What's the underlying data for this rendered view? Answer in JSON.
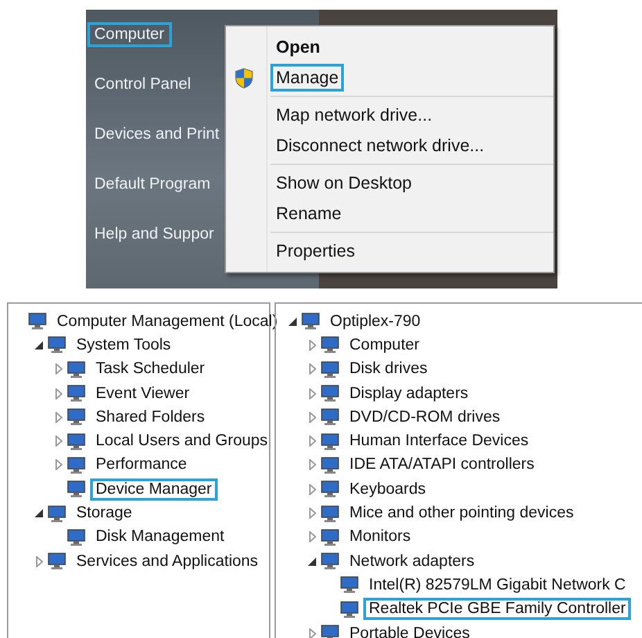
{
  "start_menu": {
    "items": [
      {
        "label": "Computer",
        "highlighted": true
      },
      {
        "label": "Control Panel",
        "highlighted": false
      },
      {
        "label": "Devices and Print",
        "highlighted": false
      },
      {
        "label": "Default Program",
        "highlighted": false
      },
      {
        "label": "Help and Suppor",
        "highlighted": false
      }
    ]
  },
  "context_menu": {
    "groups": [
      {
        "items": [
          {
            "label": "Open",
            "kind": "plain",
            "default": true,
            "highlighted": false
          },
          {
            "label": "Manage",
            "kind": "elevated",
            "default": false,
            "highlighted": true
          }
        ]
      },
      {
        "items": [
          {
            "label": "Map network drive...",
            "kind": "plain",
            "default": false,
            "highlighted": false
          },
          {
            "label": "Disconnect network drive...",
            "kind": "plain",
            "default": false,
            "highlighted": false
          }
        ]
      },
      {
        "items": [
          {
            "label": "Show on Desktop",
            "kind": "plain",
            "default": false,
            "highlighted": false
          },
          {
            "label": "Rename",
            "kind": "plain",
            "default": false,
            "highlighted": false
          }
        ]
      },
      {
        "items": [
          {
            "label": "Properties",
            "kind": "plain",
            "default": false,
            "highlighted": false
          }
        ]
      }
    ]
  },
  "management_tree": {
    "nodes": [
      {
        "label": "Computer Management (Local)",
        "highlighted": false,
        "children": [
          {
            "label": "System Tools",
            "expanded": true,
            "highlighted": false,
            "children": [
              {
                "label": "Task Scheduler",
                "expanded": false,
                "highlighted": false
              },
              {
                "label": "Event Viewer",
                "expanded": false,
                "highlighted": false
              },
              {
                "label": "Shared Folders",
                "expanded": false,
                "highlighted": false
              },
              {
                "label": "Local Users and Groups",
                "expanded": false,
                "highlighted": false
              },
              {
                "label": "Performance",
                "expanded": false,
                "highlighted": false
              },
              {
                "label": "Device Manager",
                "highlighted": true
              }
            ]
          },
          {
            "label": "Storage",
            "expanded": true,
            "highlighted": false,
            "children": [
              {
                "label": "Disk Management",
                "highlighted": false
              }
            ]
          },
          {
            "label": "Services and Applications",
            "expanded": false,
            "highlighted": false
          }
        ]
      }
    ]
  },
  "device_tree": {
    "nodes": [
      {
        "label": "Optiplex-790",
        "expanded": true,
        "highlighted": false,
        "children": [
          {
            "label": "Computer",
            "expanded": false,
            "highlighted": false
          },
          {
            "label": "Disk drives",
            "expanded": false,
            "highlighted": false
          },
          {
            "label": "Display adapters",
            "expanded": false,
            "highlighted": false
          },
          {
            "label": "DVD/CD-ROM drives",
            "expanded": false,
            "highlighted": false
          },
          {
            "label": "Human Interface Devices",
            "expanded": false,
            "highlighted": false
          },
          {
            "label": "IDE ATA/ATAPI controllers",
            "expanded": false,
            "highlighted": false
          },
          {
            "label": "Keyboards",
            "expanded": false,
            "highlighted": false
          },
          {
            "label": "Mice and other pointing devices",
            "expanded": false,
            "highlighted": false
          },
          {
            "label": "Monitors",
            "expanded": false,
            "highlighted": false
          },
          {
            "label": "Network adapters",
            "expanded": true,
            "highlighted": false,
            "children": [
              {
                "label": "Intel(R) 82579LM Gigabit Network C",
                "highlighted": false
              },
              {
                "label": "Realtek PCIe GBE Family Controller",
                "highlighted": true
              }
            ]
          },
          {
            "label": "Portable Devices",
            "expanded": false,
            "highlighted": false
          }
        ]
      }
    ]
  }
}
